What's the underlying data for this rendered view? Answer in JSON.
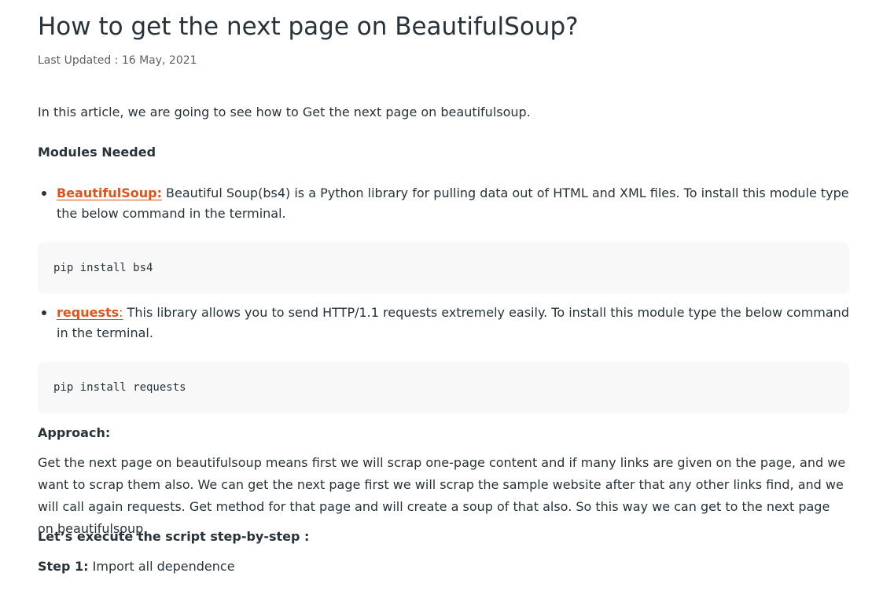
{
  "article": {
    "title": "How to get the next page on BeautifulSoup?",
    "updated": "Last Updated : 16 May, 2021",
    "intro": "In this article, we are going to see how to Get the next page on beautifulsoup.",
    "modules_heading": "Modules Needed",
    "modules": [
      {
        "link_text": "BeautifulSoup:",
        "description": " Beautiful Soup(bs4) is a Python library for pulling data out of HTML and XML files. To install this module type the below command in the terminal.",
        "command": "pip install bs4"
      },
      {
        "link_text": "requests",
        "link_suffix": ":",
        "description": " This library allows you to send HTTP/1.1 requests extremely easily. To install this module type the below command in the terminal.",
        "command": "pip install requests"
      }
    ],
    "approach_heading": "Approach:",
    "approach_text": "Get the next page on beautifulsoup means first we will scrap one-page content and if many links are given on the page, and we want to scrap them also. We can get the next page first we will scrap the sample website after that any other links find, and we will call again requests. Get method for that page and will create a soup of that also. So this way we can get to the next page on beautifulsoup.",
    "execute_heading": "Let’s execute the script step-by-step :",
    "step1_label": "Step 1:",
    "step1_text": " Import all dependence"
  }
}
